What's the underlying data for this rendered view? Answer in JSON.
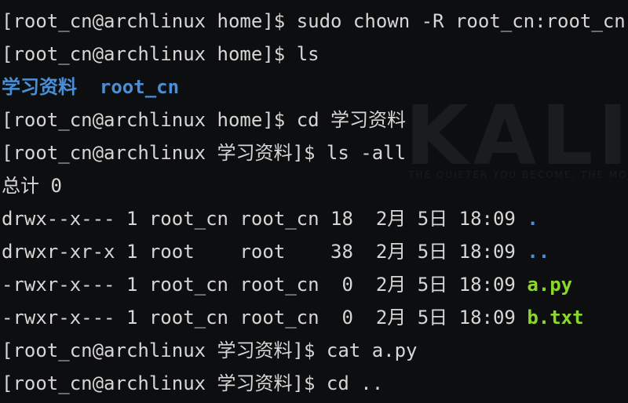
{
  "watermark": {
    "text": "KALI L",
    "tagline": "THE QUIETER YOU BECOME, THE MO"
  },
  "terminal": {
    "lines": [
      {
        "prompt": "[root_cn@archlinux home]$ ",
        "command": "sudo chown -R root_cn:root_cn 学习资料"
      },
      {
        "prompt": "[root_cn@archlinux home]$ ",
        "command": "ls"
      },
      {
        "entries": [
          "学习资料",
          "root_cn"
        ]
      },
      {
        "prompt": "[root_cn@archlinux home]$ ",
        "command": "cd 学习资料"
      },
      {
        "prompt": "[root_cn@archlinux 学习资料]$ ",
        "command": "ls -all"
      },
      {
        "text": "总计 0"
      },
      {
        "cols": "drwx--x--- 1 root_cn root_cn 18  2月 5日 18:09 ",
        "name": "."
      },
      {
        "cols": "drwxr-xr-x 1 root    root    38  2月 5日 18:09 ",
        "name": ".."
      },
      {
        "cols": "-rwxr-x--- 1 root_cn root_cn  0  2月 5日 18:09 ",
        "name": "a.py"
      },
      {
        "cols": "-rwxr-x--- 1 root_cn root_cn  0  2月 5日 18:09 ",
        "name": "b.txt"
      },
      {
        "prompt": "[root_cn@archlinux 学习资料]$ ",
        "command": "cat a.py"
      },
      {
        "prompt": "[root_cn@archlinux 学习资料]$ ",
        "command": "cd .."
      }
    ]
  },
  "colors": {
    "background": "#0d0e10",
    "foreground": "#d6d6d6",
    "directory": "#4a8fd6",
    "executable": "#8dd62e"
  }
}
